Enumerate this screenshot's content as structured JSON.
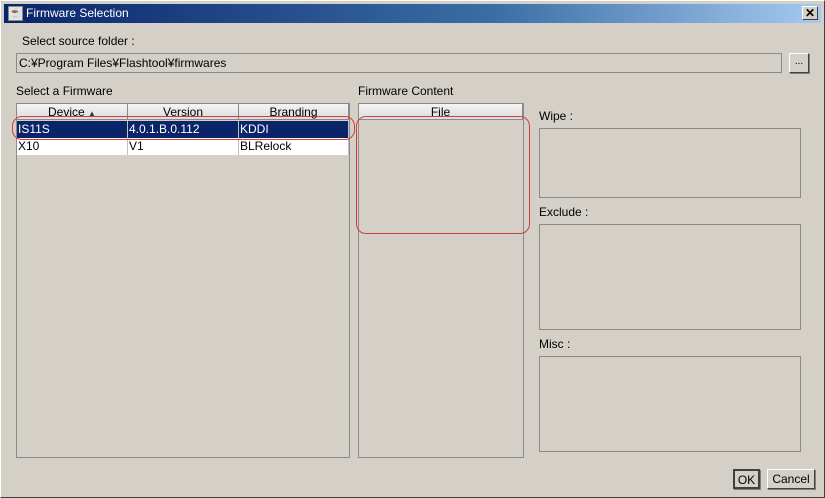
{
  "window": {
    "title": "Firmware Selection"
  },
  "source": {
    "label": "Select source folder :",
    "path": "C:¥Program Files¥Flashtool¥firmwares",
    "browse_label": "..."
  },
  "firmware_list": {
    "label": "Select a Firmware",
    "columns": [
      "Device",
      "Version",
      "Branding"
    ],
    "rows": [
      {
        "device": "IS11S",
        "version": "4.0.1.B.0.112",
        "branding": "KDDI",
        "selected": true
      },
      {
        "device": "X10",
        "version": "V1",
        "branding": "BLRelock",
        "selected": false
      }
    ]
  },
  "content": {
    "label": "Firmware Content",
    "column": "File"
  },
  "wipe": {
    "label": "Wipe :"
  },
  "exclude": {
    "label": "Exclude :"
  },
  "misc": {
    "label": "Misc :"
  },
  "buttons": {
    "ok": "OK",
    "cancel": "Cancel"
  },
  "colors": {
    "selection": "#0a246a",
    "annotation": "#d23c3c"
  }
}
